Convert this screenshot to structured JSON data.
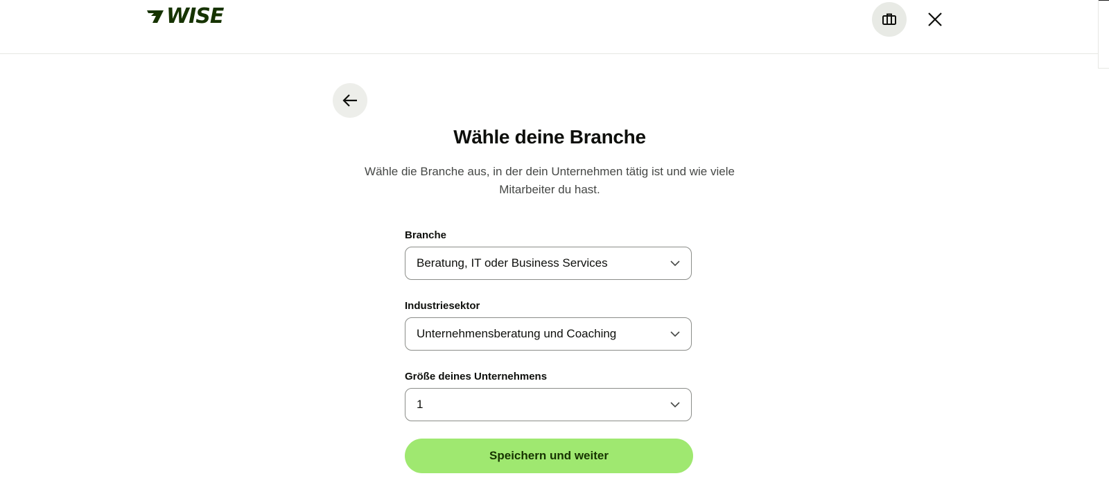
{
  "header": {
    "logo_text": "WISE",
    "logo_icon": "wise-flag-icon",
    "briefcase_icon": "briefcase-icon",
    "close_icon": "close-icon",
    "brand_color": "#163300"
  },
  "back": {
    "icon": "arrow-left-icon"
  },
  "main": {
    "title": "Wähle deine Branche",
    "subtitle": "Wähle die Branche aus, in der dein Unternehmen tätig ist und wie viele Mitarbeiter du hast."
  },
  "form": {
    "fields": [
      {
        "label": "Branche",
        "value": "Beratung, IT oder Business Services"
      },
      {
        "label": "Industriesektor",
        "value": "Unternehmensberatung und Coaching"
      },
      {
        "label": "Größe deines Unternehmens",
        "value": "1"
      }
    ],
    "chevron_icon": "chevron-down-icon",
    "submit_label": "Speichern und weiter",
    "accent_color": "#9fe870"
  }
}
